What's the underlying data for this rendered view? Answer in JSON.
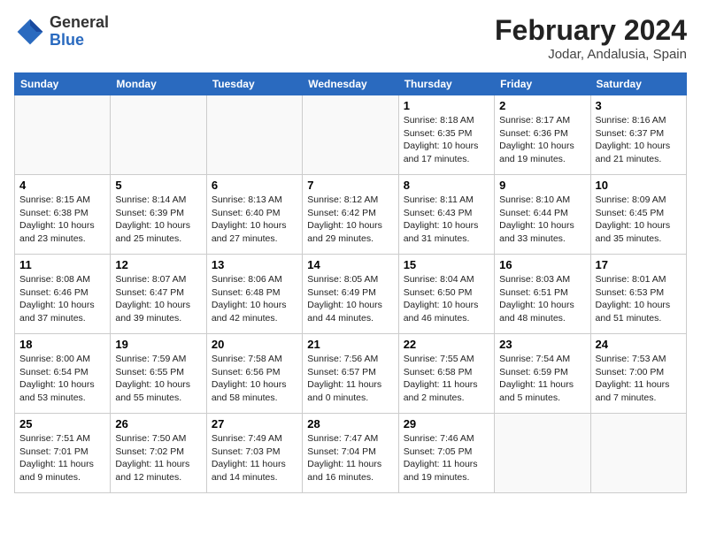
{
  "header": {
    "logo_general": "General",
    "logo_blue": "Blue",
    "month_title": "February 2024",
    "location": "Jodar, Andalusia, Spain"
  },
  "days_of_week": [
    "Sunday",
    "Monday",
    "Tuesday",
    "Wednesday",
    "Thursday",
    "Friday",
    "Saturday"
  ],
  "weeks": [
    [
      {
        "day": "",
        "info": ""
      },
      {
        "day": "",
        "info": ""
      },
      {
        "day": "",
        "info": ""
      },
      {
        "day": "",
        "info": ""
      },
      {
        "day": "1",
        "info": "Sunrise: 8:18 AM\nSunset: 6:35 PM\nDaylight: 10 hours\nand 17 minutes."
      },
      {
        "day": "2",
        "info": "Sunrise: 8:17 AM\nSunset: 6:36 PM\nDaylight: 10 hours\nand 19 minutes."
      },
      {
        "day": "3",
        "info": "Sunrise: 8:16 AM\nSunset: 6:37 PM\nDaylight: 10 hours\nand 21 minutes."
      }
    ],
    [
      {
        "day": "4",
        "info": "Sunrise: 8:15 AM\nSunset: 6:38 PM\nDaylight: 10 hours\nand 23 minutes."
      },
      {
        "day": "5",
        "info": "Sunrise: 8:14 AM\nSunset: 6:39 PM\nDaylight: 10 hours\nand 25 minutes."
      },
      {
        "day": "6",
        "info": "Sunrise: 8:13 AM\nSunset: 6:40 PM\nDaylight: 10 hours\nand 27 minutes."
      },
      {
        "day": "7",
        "info": "Sunrise: 8:12 AM\nSunset: 6:42 PM\nDaylight: 10 hours\nand 29 minutes."
      },
      {
        "day": "8",
        "info": "Sunrise: 8:11 AM\nSunset: 6:43 PM\nDaylight: 10 hours\nand 31 minutes."
      },
      {
        "day": "9",
        "info": "Sunrise: 8:10 AM\nSunset: 6:44 PM\nDaylight: 10 hours\nand 33 minutes."
      },
      {
        "day": "10",
        "info": "Sunrise: 8:09 AM\nSunset: 6:45 PM\nDaylight: 10 hours\nand 35 minutes."
      }
    ],
    [
      {
        "day": "11",
        "info": "Sunrise: 8:08 AM\nSunset: 6:46 PM\nDaylight: 10 hours\nand 37 minutes."
      },
      {
        "day": "12",
        "info": "Sunrise: 8:07 AM\nSunset: 6:47 PM\nDaylight: 10 hours\nand 39 minutes."
      },
      {
        "day": "13",
        "info": "Sunrise: 8:06 AM\nSunset: 6:48 PM\nDaylight: 10 hours\nand 42 minutes."
      },
      {
        "day": "14",
        "info": "Sunrise: 8:05 AM\nSunset: 6:49 PM\nDaylight: 10 hours\nand 44 minutes."
      },
      {
        "day": "15",
        "info": "Sunrise: 8:04 AM\nSunset: 6:50 PM\nDaylight: 10 hours\nand 46 minutes."
      },
      {
        "day": "16",
        "info": "Sunrise: 8:03 AM\nSunset: 6:51 PM\nDaylight: 10 hours\nand 48 minutes."
      },
      {
        "day": "17",
        "info": "Sunrise: 8:01 AM\nSunset: 6:53 PM\nDaylight: 10 hours\nand 51 minutes."
      }
    ],
    [
      {
        "day": "18",
        "info": "Sunrise: 8:00 AM\nSunset: 6:54 PM\nDaylight: 10 hours\nand 53 minutes."
      },
      {
        "day": "19",
        "info": "Sunrise: 7:59 AM\nSunset: 6:55 PM\nDaylight: 10 hours\nand 55 minutes."
      },
      {
        "day": "20",
        "info": "Sunrise: 7:58 AM\nSunset: 6:56 PM\nDaylight: 10 hours\nand 58 minutes."
      },
      {
        "day": "21",
        "info": "Sunrise: 7:56 AM\nSunset: 6:57 PM\nDaylight: 11 hours\nand 0 minutes."
      },
      {
        "day": "22",
        "info": "Sunrise: 7:55 AM\nSunset: 6:58 PM\nDaylight: 11 hours\nand 2 minutes."
      },
      {
        "day": "23",
        "info": "Sunrise: 7:54 AM\nSunset: 6:59 PM\nDaylight: 11 hours\nand 5 minutes."
      },
      {
        "day": "24",
        "info": "Sunrise: 7:53 AM\nSunset: 7:00 PM\nDaylight: 11 hours\nand 7 minutes."
      }
    ],
    [
      {
        "day": "25",
        "info": "Sunrise: 7:51 AM\nSunset: 7:01 PM\nDaylight: 11 hours\nand 9 minutes."
      },
      {
        "day": "26",
        "info": "Sunrise: 7:50 AM\nSunset: 7:02 PM\nDaylight: 11 hours\nand 12 minutes."
      },
      {
        "day": "27",
        "info": "Sunrise: 7:49 AM\nSunset: 7:03 PM\nDaylight: 11 hours\nand 14 minutes."
      },
      {
        "day": "28",
        "info": "Sunrise: 7:47 AM\nSunset: 7:04 PM\nDaylight: 11 hours\nand 16 minutes."
      },
      {
        "day": "29",
        "info": "Sunrise: 7:46 AM\nSunset: 7:05 PM\nDaylight: 11 hours\nand 19 minutes."
      },
      {
        "day": "",
        "info": ""
      },
      {
        "day": "",
        "info": ""
      }
    ]
  ]
}
